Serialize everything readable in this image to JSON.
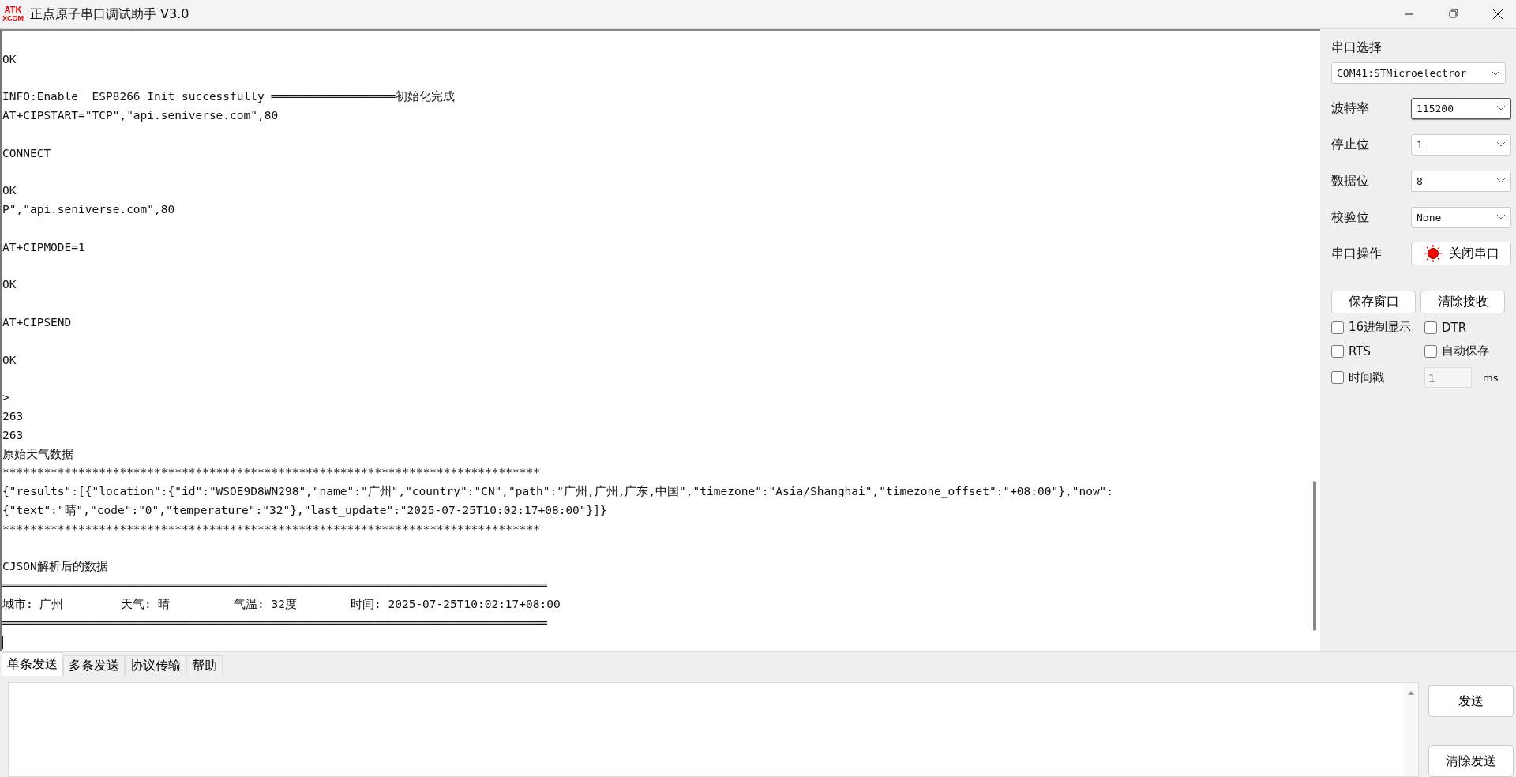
{
  "window": {
    "title": "正点原子串口调试助手 V3.0",
    "logo_top": "ATK",
    "logo_bottom": "XCOM"
  },
  "log": {
    "lines": [
      {
        "kind": "blank"
      },
      {
        "kind": "text",
        "text": "OK"
      },
      {
        "kind": "blank"
      },
      {
        "kind": "text",
        "text": "INFO:Enable  ESP8266_Init successfully ══════════════════初始化完成"
      },
      {
        "kind": "text",
        "text": "AT+CIPSTART=\"TCP\",\"api.seniverse.com\",80"
      },
      {
        "kind": "blank"
      },
      {
        "kind": "text",
        "text": "CONNECT"
      },
      {
        "kind": "blank"
      },
      {
        "kind": "text",
        "text": "OK"
      },
      {
        "kind": "text",
        "text": "P\",\"api.seniverse.com\",80"
      },
      {
        "kind": "blank"
      },
      {
        "kind": "text",
        "text": "AT+CIPMODE=1"
      },
      {
        "kind": "blank"
      },
      {
        "kind": "text",
        "text": "OK"
      },
      {
        "kind": "blank"
      },
      {
        "kind": "text",
        "text": "AT+CIPSEND"
      },
      {
        "kind": "blank"
      },
      {
        "kind": "text",
        "text": "OK"
      },
      {
        "kind": "blank"
      },
      {
        "kind": "text",
        "text": ">"
      },
      {
        "kind": "text",
        "text": "263"
      },
      {
        "kind": "text",
        "text": "263"
      },
      {
        "kind": "text",
        "text": "原始天气数据"
      },
      {
        "kind": "text",
        "text": "******************************************************************************"
      },
      {
        "kind": "text",
        "text": "{\"results\":[{\"location\":{\"id\":\"WSOE9D8WN298\",\"name\":\"广州\",\"country\":\"CN\",\"path\":\"广州,广州,广东,中国\",\"timezone\":\"Asia/Shanghai\",\"timezone_offset\":\"+08:00\"},\"now\":"
      },
      {
        "kind": "text",
        "text": "{\"text\":\"晴\",\"code\":\"0\",\"temperature\":\"32\"},\"last_update\":\"2025-07-25T10:02:17+08:00\"}]}"
      },
      {
        "kind": "text",
        "text": "******************************************************************************"
      },
      {
        "kind": "blank"
      },
      {
        "kind": "text",
        "text": "CJSON解析后的数据"
      },
      {
        "kind": "text",
        "text": "═══════════════════════════════════════════════════════════════════════════════"
      },
      {
        "kind": "fields",
        "items": [
          "城市: 广州",
          "天气: 晴",
          "气温: 32度",
          "时间: 2025-07-25T10:02:17+08:00"
        ]
      },
      {
        "kind": "text",
        "text": "═══════════════════════════════════════════════════════════════════════════════"
      },
      {
        "kind": "cursor"
      }
    ]
  },
  "serial": {
    "port_label": "串口选择",
    "port": "COM41:STMicroelectror",
    "settings": [
      {
        "label": "波特率",
        "value": "115200",
        "focused": true
      },
      {
        "label": "停止位",
        "value": "1",
        "focused": false
      },
      {
        "label": "数据位",
        "value": "8",
        "focused": false
      },
      {
        "label": "校验位",
        "value": "None",
        "focused": false
      }
    ],
    "operation": {
      "label": "串口操作",
      "button": "关闭串口",
      "open": true
    },
    "buttons": [
      "保存窗口",
      "清除接收"
    ],
    "options": [
      {
        "label": "16进制显示",
        "checked": false
      },
      {
        "label": "DTR",
        "checked": false
      },
      {
        "label": "RTS",
        "checked": false
      },
      {
        "label": "自动保存",
        "checked": false
      },
      {
        "label": "时间戳",
        "checked": false
      }
    ],
    "interval": {
      "value": "1",
      "unit": "ms",
      "disabled": true
    }
  },
  "send_tabs": [
    {
      "label": "单条发送",
      "selected": true
    },
    {
      "label": "多条发送",
      "selected": false
    },
    {
      "label": "协议传输",
      "selected": false
    },
    {
      "label": "帮助",
      "selected": false
    }
  ],
  "send_buttons": [
    "发送",
    "清除发送"
  ]
}
